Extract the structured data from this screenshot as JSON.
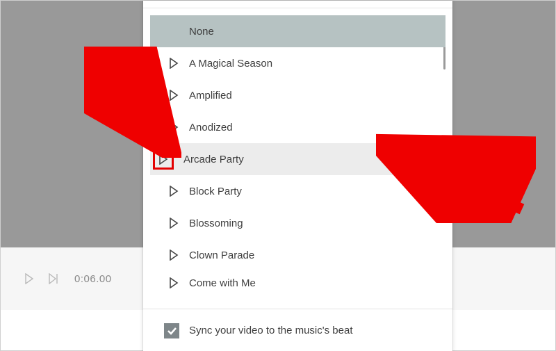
{
  "music_list": {
    "items": [
      {
        "label": "None",
        "has_play": false,
        "selected": true
      },
      {
        "label": "A Magical Season",
        "has_play": true
      },
      {
        "label": "Amplified",
        "has_play": true
      },
      {
        "label": "Anodized",
        "has_play": true
      },
      {
        "label": "Arcade Party",
        "has_play": true,
        "hovered": true,
        "highlighted_play": true
      },
      {
        "label": "Block Party",
        "has_play": true
      },
      {
        "label": "Blossoming",
        "has_play": true
      },
      {
        "label": "Clown Parade",
        "has_play": true
      },
      {
        "label": "Come with Me",
        "has_play": true,
        "cutoff": true
      }
    ]
  },
  "sync_option": {
    "checked": true,
    "label": "Sync your video to the music's beat"
  },
  "toolbar": {
    "time": "0:06.00"
  },
  "annotations": {
    "arrow_left": {
      "points_to": "arcade-party-play-icon"
    },
    "arrow_right": {
      "points_to": "arcade-party-row"
    }
  }
}
